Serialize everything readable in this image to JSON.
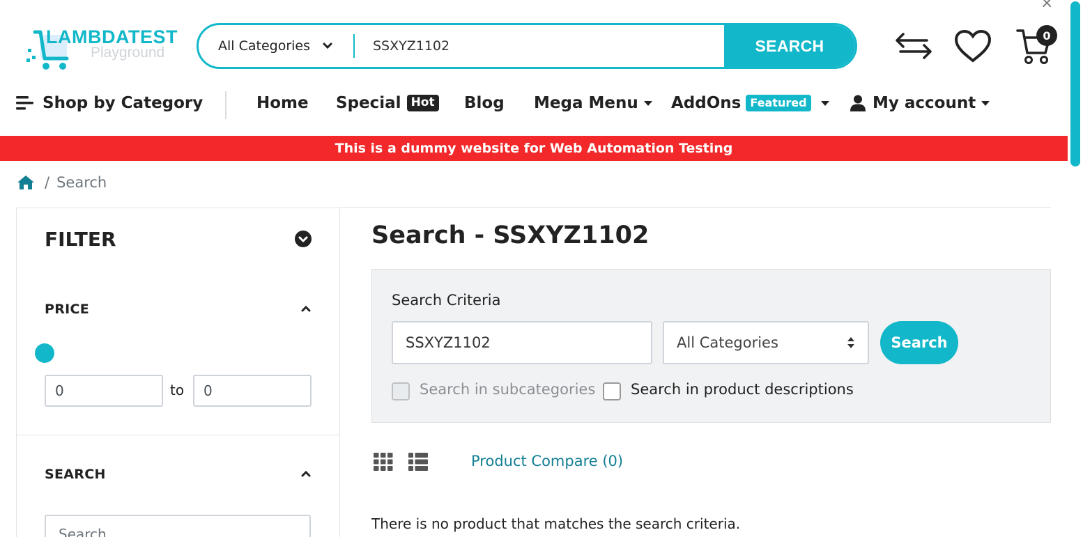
{
  "header": {
    "logo_title": "LAMBDATEST",
    "logo_subtitle": "Playground",
    "search": {
      "category": "All Categories",
      "query": "SSXYZ1102",
      "button_label": "SEARCH"
    },
    "cart_count": "0",
    "close_glyph": "×"
  },
  "nav": {
    "shop_by_category": "Shop by Category",
    "home": "Home",
    "special": "Special",
    "special_badge": "Hot",
    "blog": "Blog",
    "mega_menu": "Mega Menu",
    "addons": "AddOns",
    "addons_badge": "Featured",
    "my_account": "My account"
  },
  "banner": "This is a dummy website for Web Automation Testing",
  "breadcrumb": {
    "separator": "/",
    "current": "Search"
  },
  "sidebar": {
    "filter_title": "FILTER",
    "price": {
      "title": "PRICE",
      "min": "0",
      "max": "0",
      "to_label": "to"
    },
    "search": {
      "title": "SEARCH",
      "placeholder": "Search"
    }
  },
  "main": {
    "title": "Search - SSXYZ1102",
    "criteria": {
      "label": "Search Criteria",
      "query": "SSXYZ1102",
      "category": "All Categories",
      "button_label": "Search",
      "subcategories_label": "Search in subcategories",
      "descriptions_label": "Search in product descriptions"
    },
    "product_compare": "Product Compare (0)",
    "no_results": "There is no product that matches the search criteria."
  },
  "colors": {
    "accent": "#12b8c9",
    "banner": "#f2282a",
    "link": "#127f93"
  },
  "icons": [
    "cart-logo-icon",
    "chevron-down-icon",
    "compare-arrows-icon",
    "heart-icon",
    "cart-icon",
    "menu-icon",
    "user-icon",
    "home-icon",
    "chevron-up-icon",
    "grid-view-icon",
    "list-view-icon",
    "sort-arrows-icon"
  ]
}
